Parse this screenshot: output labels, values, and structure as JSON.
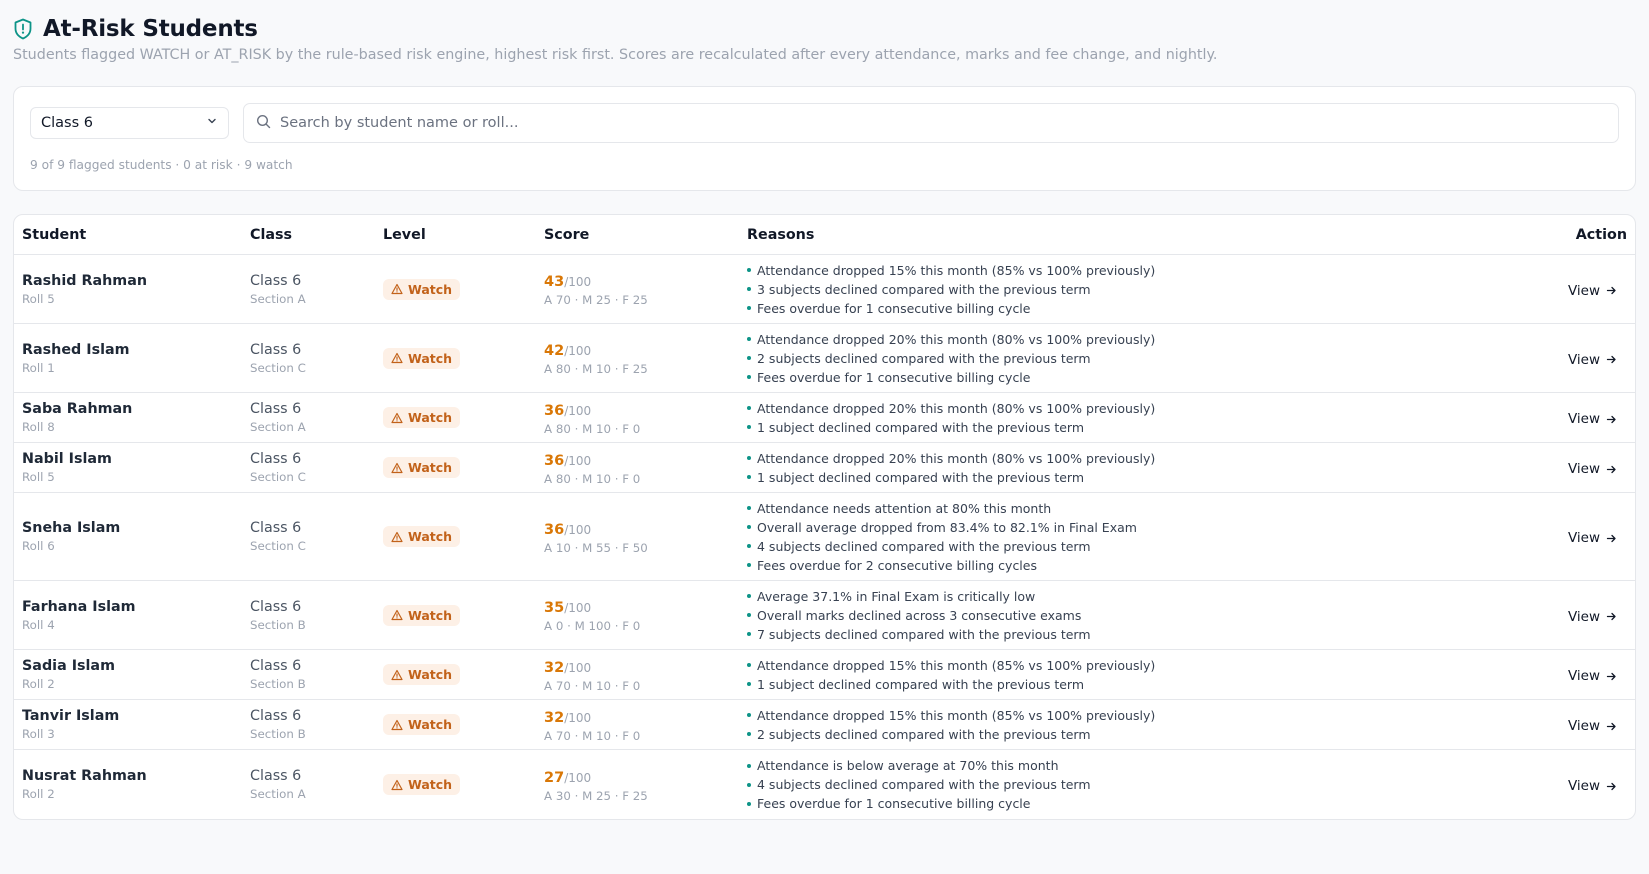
{
  "header": {
    "title": "At-Risk Students",
    "subtitle": "Students flagged WATCH or AT_RISK by the rule-based risk engine, highest risk first. Scores are recalculated after every attendance, marks and fee change, and nightly."
  },
  "filters": {
    "class_select": "Class 6",
    "search_placeholder": "Search by student name or roll...",
    "summary": "9 of 9 flagged students · 0 at risk · 9 watch"
  },
  "table": {
    "columns": {
      "student": "Student",
      "class": "Class",
      "level": "Level",
      "score": "Score",
      "reasons": "Reasons",
      "action": "Action"
    },
    "rows": [
      {
        "name": "Rashid Rahman",
        "roll": "Roll 5",
        "class": "Class 6",
        "section": "Section A",
        "level": "Watch",
        "score": "43",
        "max": "/100",
        "breakdown": "A 70 · M 25 · F 25",
        "action": "View",
        "reasons": [
          "Attendance dropped 15% this month (85% vs 100% previously)",
          "3 subjects declined compared with the previous term",
          "Fees overdue for 1 consecutive billing cycle"
        ]
      },
      {
        "name": "Rashed Islam",
        "roll": "Roll 1",
        "class": "Class 6",
        "section": "Section C",
        "level": "Watch",
        "score": "42",
        "max": "/100",
        "breakdown": "A 80 · M 10 · F 25",
        "action": "View",
        "reasons": [
          "Attendance dropped 20% this month (80% vs 100% previously)",
          "2 subjects declined compared with the previous term",
          "Fees overdue for 1 consecutive billing cycle"
        ]
      },
      {
        "name": "Saba Rahman",
        "roll": "Roll 8",
        "class": "Class 6",
        "section": "Section A",
        "level": "Watch",
        "score": "36",
        "max": "/100",
        "breakdown": "A 80 · M 10 · F 0",
        "action": "View",
        "reasons": [
          "Attendance dropped 20% this month (80% vs 100% previously)",
          "1 subject declined compared with the previous term"
        ]
      },
      {
        "name": "Nabil Islam",
        "roll": "Roll 5",
        "class": "Class 6",
        "section": "Section C",
        "level": "Watch",
        "score": "36",
        "max": "/100",
        "breakdown": "A 80 · M 10 · F 0",
        "action": "View",
        "reasons": [
          "Attendance dropped 20% this month (80% vs 100% previously)",
          "1 subject declined compared with the previous term"
        ]
      },
      {
        "name": "Sneha Islam",
        "roll": "Roll 6",
        "class": "Class 6",
        "section": "Section C",
        "level": "Watch",
        "score": "36",
        "max": "/100",
        "breakdown": "A 10 · M 55 · F 50",
        "action": "View",
        "reasons": [
          "Attendance needs attention at 80% this month",
          "Overall average dropped from 83.4% to 82.1% in Final Exam",
          "4 subjects declined compared with the previous term",
          "Fees overdue for 2 consecutive billing cycles"
        ]
      },
      {
        "name": "Farhana Islam",
        "roll": "Roll 4",
        "class": "Class 6",
        "section": "Section B",
        "level": "Watch",
        "score": "35",
        "max": "/100",
        "breakdown": "A 0 · M 100 · F 0",
        "action": "View",
        "reasons": [
          "Average 37.1% in Final Exam is critically low",
          "Overall marks declined across 3 consecutive exams",
          "7 subjects declined compared with the previous term"
        ]
      },
      {
        "name": "Sadia Islam",
        "roll": "Roll 2",
        "class": "Class 6",
        "section": "Section B",
        "level": "Watch",
        "score": "32",
        "max": "/100",
        "breakdown": "A 70 · M 10 · F 0",
        "action": "View",
        "reasons": [
          "Attendance dropped 15% this month (85% vs 100% previously)",
          "1 subject declined compared with the previous term"
        ]
      },
      {
        "name": "Tanvir Islam",
        "roll": "Roll 3",
        "class": "Class 6",
        "section": "Section B",
        "level": "Watch",
        "score": "32",
        "max": "/100",
        "breakdown": "A 70 · M 10 · F 0",
        "action": "View",
        "reasons": [
          "Attendance dropped 15% this month (85% vs 100% previously)",
          "2 subjects declined compared with the previous term"
        ]
      },
      {
        "name": "Nusrat Rahman",
        "roll": "Roll 2",
        "class": "Class 6",
        "section": "Section A",
        "level": "Watch",
        "score": "27",
        "max": "/100",
        "breakdown": "A 30 · M 25 · F 25",
        "action": "View",
        "reasons": [
          "Attendance is below average at 70% this month",
          "4 subjects declined compared with the previous term",
          "Fees overdue for 1 consecutive billing cycle"
        ]
      }
    ]
  },
  "colors": {
    "accent": "#0d9488",
    "watch_bg": "#fdf0e6",
    "watch_text": "#c2621a",
    "score": "#d97706"
  },
  "icons": {
    "title": "shield-alert-icon",
    "select": "chevron-down-icon",
    "search": "search-icon",
    "badge": "alert-triangle-icon",
    "action": "arrow-right-icon"
  }
}
